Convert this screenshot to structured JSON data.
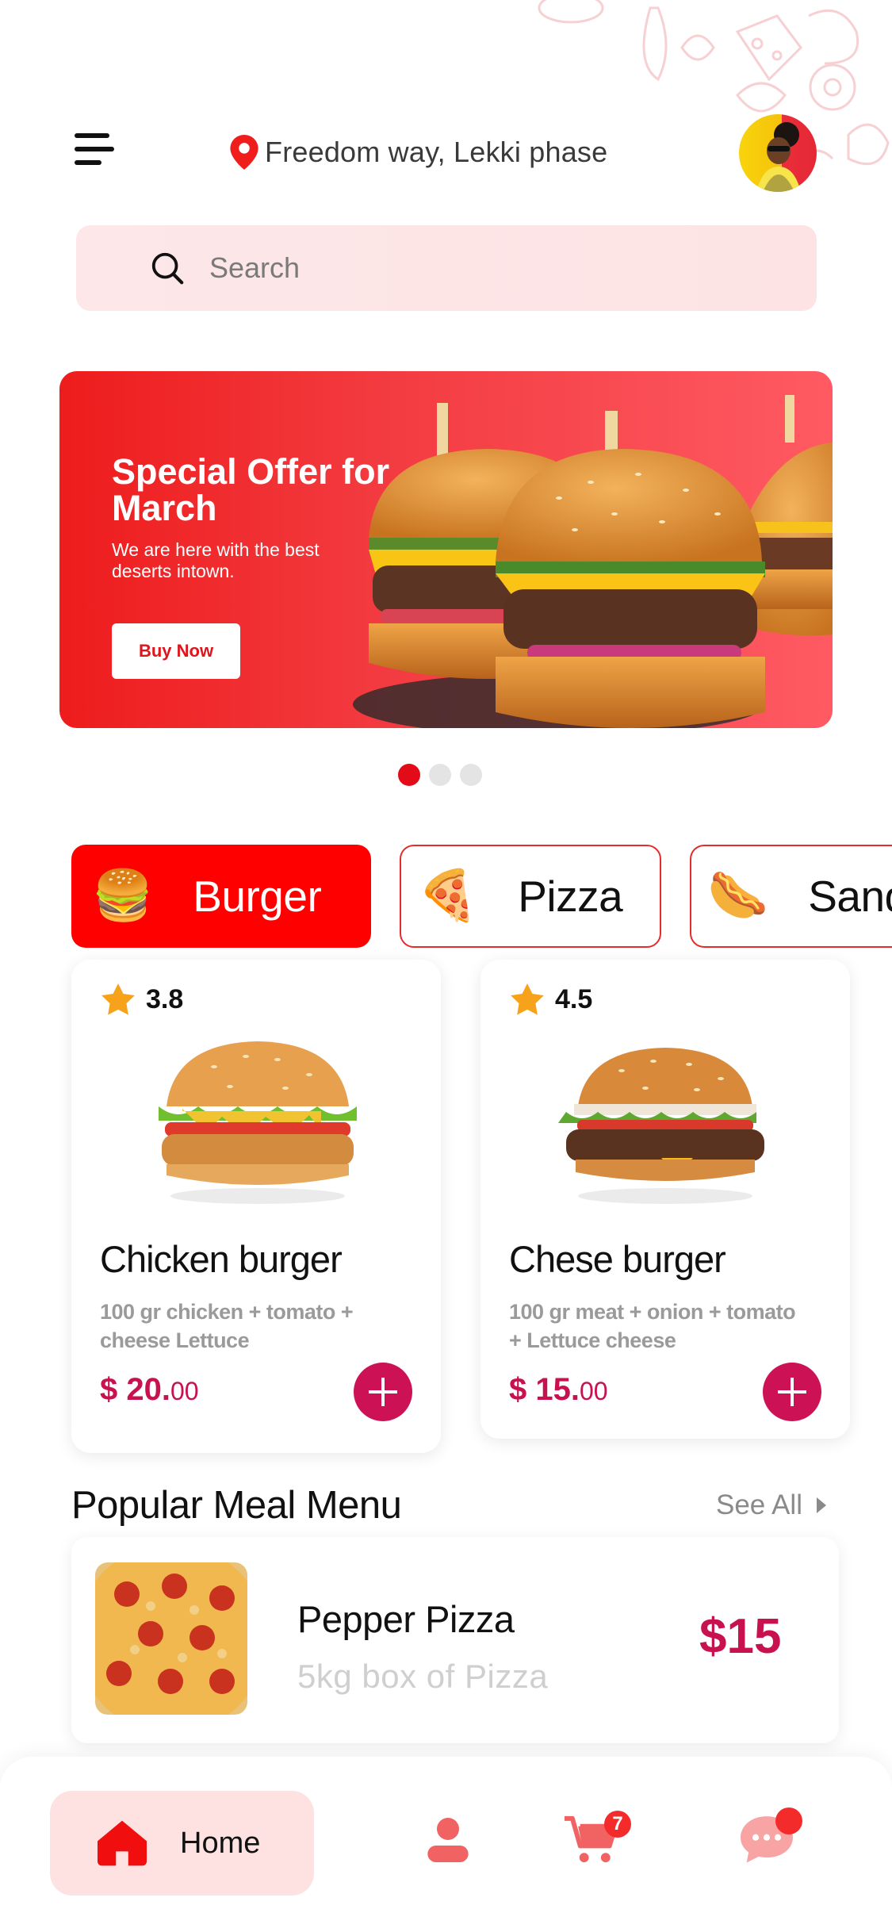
{
  "header": {
    "location": "Freedom way, Lekki phase"
  },
  "search": {
    "placeholder": "Search"
  },
  "banner": {
    "title": "Special Offer for March",
    "subtitle": "We are here with the best deserts intown.",
    "button_label": "Buy Now",
    "carousel": {
      "total": 3,
      "active_index": 0
    }
  },
  "categories": [
    {
      "label": "Burger",
      "icon": "burger-icon",
      "active": true
    },
    {
      "label": "Pizza",
      "icon": "pizza-icon",
      "active": false
    },
    {
      "label": "Sand",
      "icon": "hotdog-icon",
      "active": false
    }
  ],
  "products": [
    {
      "rating": "3.8",
      "title": "Chicken burger",
      "description": "100 gr chicken + tomato + cheese  Lettuce",
      "price_main": "$ 20.",
      "price_cents": "00"
    },
    {
      "rating": "4.5",
      "title": "Chese burger",
      "description": "100 gr meat + onion + tomato + Lettuce cheese",
      "price_main": "$ 15.",
      "price_cents": "00"
    }
  ],
  "popular": {
    "title": "Popular Meal Menu",
    "see_all": "See All",
    "items": [
      {
        "title": "Pepper Pizza",
        "subtitle": "5kg box of Pizza",
        "price": "$15"
      }
    ]
  },
  "bottom_nav": {
    "home_label": "Home",
    "cart_badge": "7"
  },
  "colors": {
    "primary": "#FE0000",
    "accent": "#C8124F",
    "search_bg": "#FDE7E8"
  }
}
